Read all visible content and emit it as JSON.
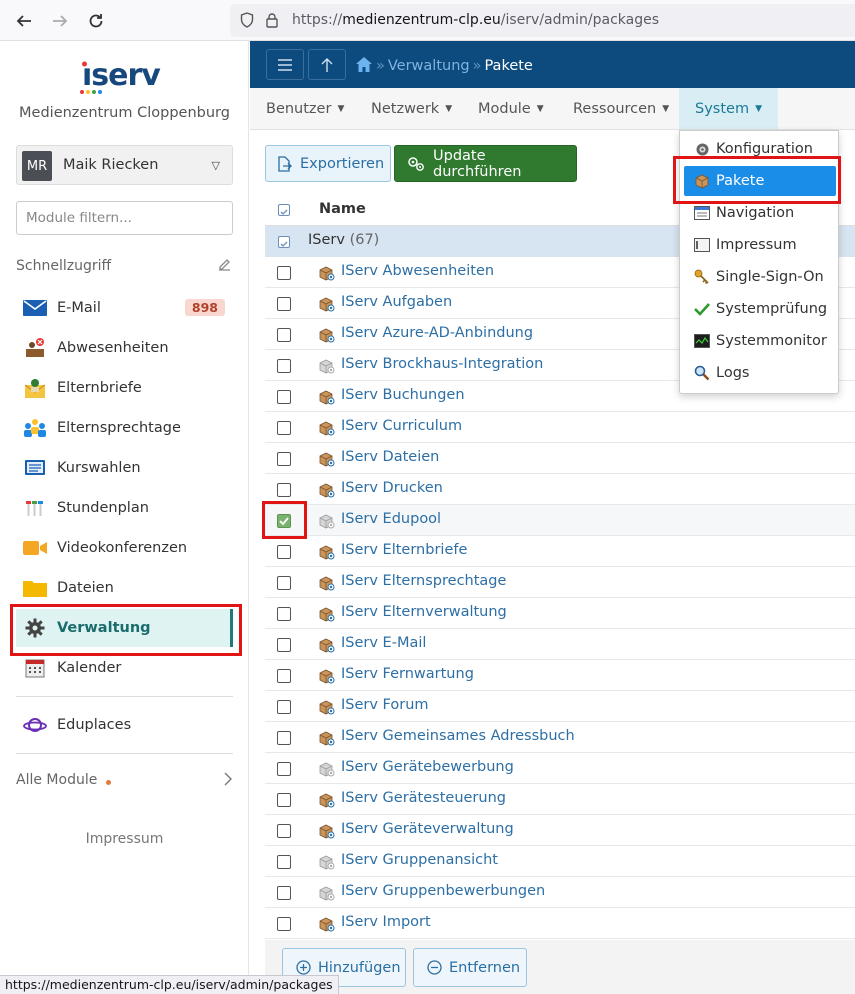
{
  "browser": {
    "url_prefix": "https://",
    "url_domain": "medienzentrum-clp.eu",
    "url_path": "/iserv/admin/packages",
    "status_url": "https://medienzentrum-clp.eu/iserv/admin/packages"
  },
  "sidebar": {
    "logo_text": "IServ",
    "school": "Medienzentrum Cloppenburg",
    "user": {
      "initials": "MR",
      "name": "Maik Riecken"
    },
    "filter_placeholder": "Module filtern...",
    "quick_access_label": "Schnellzugriff",
    "items": [
      {
        "label": "E-Mail",
        "badge": "898",
        "icon": "mail-icon"
      },
      {
        "label": "Abwesenheiten",
        "icon": "absence-icon"
      },
      {
        "label": "Elternbriefe",
        "icon": "letter-icon"
      },
      {
        "label": "Elternsprechtage",
        "icon": "people-icon"
      },
      {
        "label": "Kurswahlen",
        "icon": "list-icon"
      },
      {
        "label": "Stundenplan",
        "icon": "timetable-icon"
      },
      {
        "label": "Videokonferenzen",
        "icon": "video-icon"
      },
      {
        "label": "Dateien",
        "icon": "folder-icon"
      },
      {
        "label": "Verwaltung",
        "icon": "gear-icon",
        "active": true
      },
      {
        "label": "Kalender",
        "icon": "calendar-icon"
      }
    ],
    "eduplaces_label": "Eduplaces",
    "all_modules_label": "Alle Module",
    "impressum_label": "Impressum"
  },
  "topnav": {
    "breadcrumb": [
      "Verwaltung",
      "Pakete"
    ]
  },
  "menubar": {
    "items": [
      {
        "label": "Benutzer"
      },
      {
        "label": "Netzwerk"
      },
      {
        "label": "Module"
      },
      {
        "label": "Ressourcen"
      },
      {
        "label": "System",
        "open": true
      }
    ]
  },
  "dropdown": {
    "items": [
      {
        "label": "Konfiguration",
        "icon": "cog-icon"
      },
      {
        "label": "Pakete",
        "icon": "package-icon",
        "selected": true
      },
      {
        "label": "Navigation",
        "icon": "navigation-icon"
      },
      {
        "label": "Impressum",
        "icon": "impressum-icon"
      },
      {
        "label": "Single-Sign-On",
        "icon": "key-icon"
      },
      {
        "label": "Systemprüfung",
        "icon": "check-icon"
      },
      {
        "label": "Systemmonitor",
        "icon": "monitor-icon"
      },
      {
        "label": "Logs",
        "icon": "magnifier-icon"
      }
    ]
  },
  "toolbar": {
    "export_label": "Exportieren",
    "update_label": "Update durchführen"
  },
  "table": {
    "header_name": "Name",
    "group_name": "IServ",
    "group_count": "(67)",
    "rows": [
      {
        "name": "IServ Abwesenheiten",
        "checked": false,
        "installed": true
      },
      {
        "name": "IServ Aufgaben",
        "checked": false,
        "installed": true
      },
      {
        "name": "IServ Azure-AD-Anbindung",
        "checked": false,
        "installed": true
      },
      {
        "name": "IServ Brockhaus-Integration",
        "checked": false,
        "installed": false
      },
      {
        "name": "IServ Buchungen",
        "checked": false,
        "installed": true
      },
      {
        "name": "IServ Curriculum",
        "checked": false,
        "installed": true
      },
      {
        "name": "IServ Dateien",
        "checked": false,
        "installed": true
      },
      {
        "name": "IServ Drucken",
        "checked": false,
        "installed": true
      },
      {
        "name": "IServ Edupool",
        "checked": true,
        "installed": false
      },
      {
        "name": "IServ Elternbriefe",
        "checked": false,
        "installed": true
      },
      {
        "name": "IServ Elternsprechtage",
        "checked": false,
        "installed": true
      },
      {
        "name": "IServ Elternverwaltung",
        "checked": false,
        "installed": true
      },
      {
        "name": "IServ E-Mail",
        "checked": false,
        "installed": true
      },
      {
        "name": "IServ Fernwartung",
        "checked": false,
        "installed": true
      },
      {
        "name": "IServ Forum",
        "checked": false,
        "installed": true
      },
      {
        "name": "IServ Gemeinsames Adressbuch",
        "checked": false,
        "installed": true
      },
      {
        "name": "IServ Gerätebewerbung",
        "checked": false,
        "installed": false
      },
      {
        "name": "IServ Gerätesteuerung",
        "checked": false,
        "installed": true
      },
      {
        "name": "IServ Geräteverwaltung",
        "checked": false,
        "installed": true
      },
      {
        "name": "IServ Gruppenansicht",
        "checked": false,
        "installed": false
      },
      {
        "name": "IServ Gruppenbewerbungen",
        "checked": false,
        "installed": false
      },
      {
        "name": "IServ Import",
        "checked": false,
        "installed": true
      }
    ]
  },
  "bottombar": {
    "add_label": "Hinzufügen",
    "remove_label": "Entfernen"
  },
  "colors": {
    "nav_blue": "#0d4a7e",
    "update_green": "#2f7a2f",
    "highlight_red": "#e01414",
    "dropdown_selected": "#1a8de8"
  }
}
